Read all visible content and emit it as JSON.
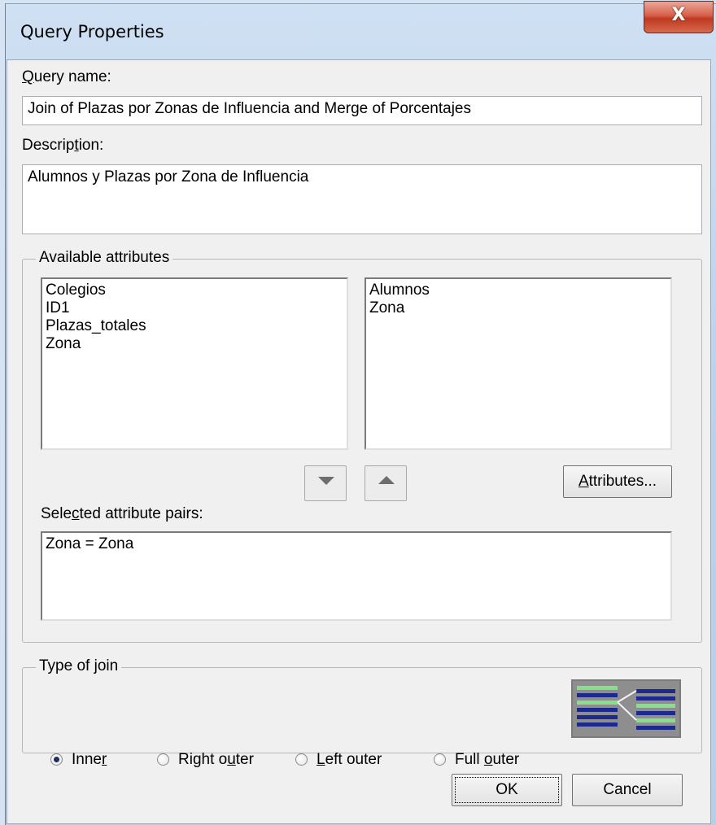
{
  "window": {
    "title": "Query Properties",
    "close_glyph": "X"
  },
  "query_name": {
    "label": "Query name:",
    "value": "Join of Plazas por Zonas de Influencia and Merge of Porcentajes"
  },
  "description": {
    "label": "Description:",
    "value": "Alumnos y Plazas por Zona de Influencia"
  },
  "available_attributes": {
    "title": "Available attributes",
    "left_list": [
      "Colegios",
      "ID1",
      "Plazas_totales",
      "Zona"
    ],
    "right_list": [
      "Alumnos",
      "Zona"
    ],
    "move_down_icon": "triangle-down",
    "move_up_icon": "triangle-up",
    "attributes_button": "Attributes..."
  },
  "selected_pairs": {
    "label": "Selected attribute pairs:",
    "items": [
      "Zona = Zona"
    ]
  },
  "join_type": {
    "title": "Type of join",
    "options": [
      "Inner",
      "Right outer",
      "Left outer",
      "Full outer"
    ],
    "selected": "Inner",
    "diagram_icon": "inner-join-diagram"
  },
  "buttons": {
    "ok": "OK",
    "cancel": "Cancel"
  }
}
